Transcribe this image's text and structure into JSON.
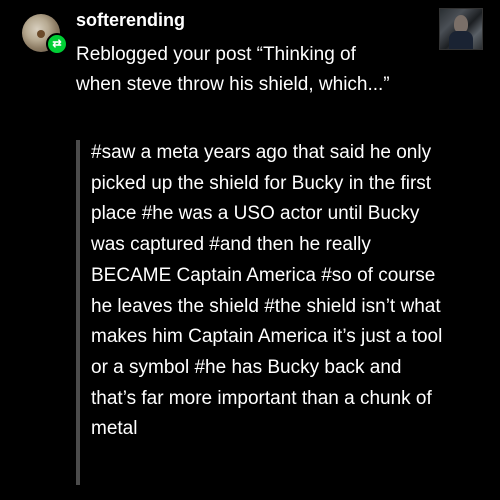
{
  "user": {
    "username": "softerending"
  },
  "badge": {
    "icon": "reblog-icon",
    "symbol": "⇄",
    "color": "#00cf35"
  },
  "notification": {
    "prefix": "Reblogged your post ",
    "post_excerpt": "“Thinking of when steve throw his shield, which...”"
  },
  "reblog": {
    "tags_text": "#saw a meta years ago that said he only picked up the shield for Bucky in the first place #he was a USO actor until Bucky was captured #and then he really BECAME Captain America #so of course he leaves the shield #the shield isn’t what makes him Captain America it’s just a tool or a symbol #he has Bucky back and that’s far more important than a chunk of metal"
  }
}
